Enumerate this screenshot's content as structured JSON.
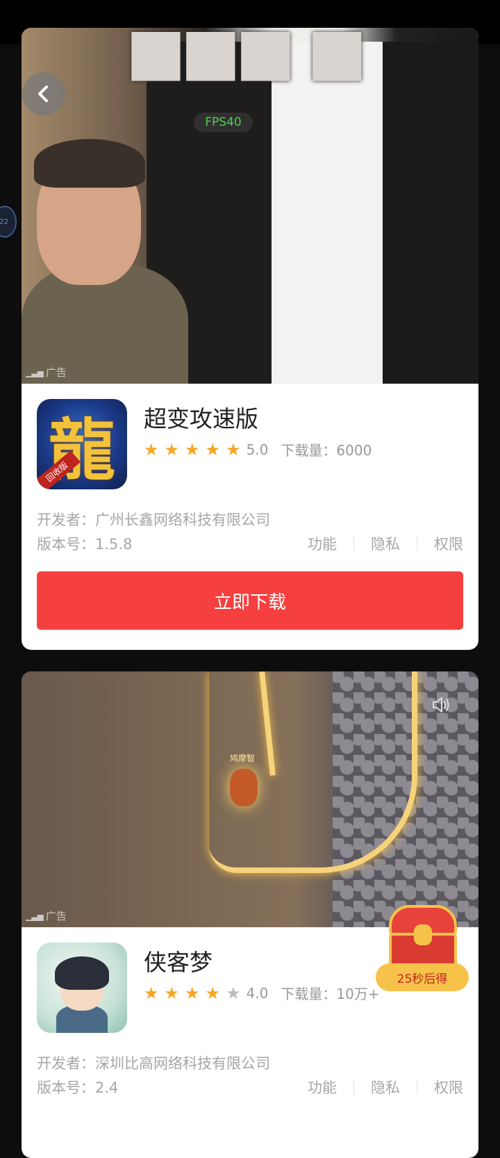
{
  "overlay": {
    "fps_label": "FPS40",
    "side_bubble_text": "22"
  },
  "apps": [
    {
      "name": "超变攻速版",
      "rating": 5.0,
      "rating_text": "5.0",
      "stars_filled": 5,
      "downloads_text": "下载量：6000",
      "developer_text": "开发者：广州长鑫网络科技有限公司",
      "version_text": "版本号：1.5.8",
      "ad_label": "广告",
      "icon_glyph": "龍",
      "icon_ribbon": "回收版",
      "download_label": "立即下载"
    },
    {
      "name": "侠客梦",
      "rating": 4.0,
      "rating_text": "4.0",
      "stars_filled": 4,
      "downloads_text": "下载量：10万+",
      "developer_text": "开发者：深圳比高网络科技有限公司",
      "version_text": "版本号：2.4",
      "ad_label": "广告",
      "video_hero_name": "鸠摩智"
    }
  ],
  "links": {
    "features": "功能",
    "privacy": "隐私",
    "permissions": "权限"
  },
  "reward": {
    "timer_text": "25秒后得"
  },
  "colors": {
    "accent_red": "#f5403f",
    "star_gold": "#f5a623",
    "fps_green": "#4cd14c"
  }
}
